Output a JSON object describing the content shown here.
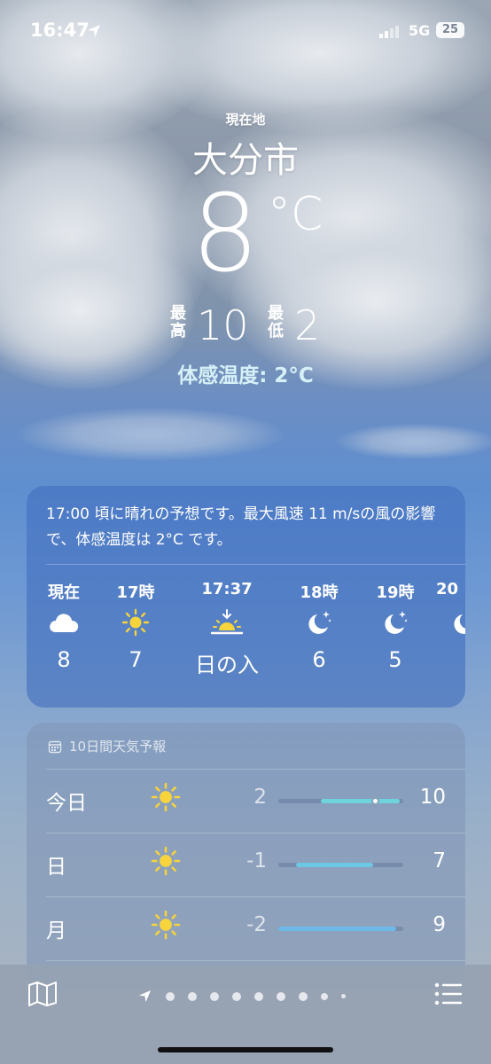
{
  "status": {
    "time": "16:47",
    "network": "5G",
    "battery": "25"
  },
  "hero": {
    "location_label": "現在地",
    "city": "大分市",
    "temp": "8",
    "unit": "°C",
    "high_label": "最高",
    "high": "10",
    "low_label": "最低",
    "low": "2",
    "feels_like": "体感温度: 2°C"
  },
  "hourly": {
    "summary": "17:00 頃に晴れの予想です。最大風速 11 m/sの風の影響で、体感温度は 2°C です。",
    "items": [
      {
        "label": "現在",
        "icon": "cloud-icon",
        "temp": "8"
      },
      {
        "label": "17時",
        "icon": "sun-icon",
        "temp": "7"
      },
      {
        "label": "17:37",
        "icon": "sunset-icon",
        "temp": "日の入"
      },
      {
        "label": "18時",
        "icon": "moon-stars-icon",
        "temp": "6"
      },
      {
        "label": "19時",
        "icon": "moon-stars-icon",
        "temp": "5"
      },
      {
        "label": "20",
        "icon": "moon-stars-icon",
        "temp": ""
      }
    ]
  },
  "daily": {
    "header": "10日間天気予報",
    "rows": [
      {
        "day": "今日",
        "icon": "sun-icon",
        "low": "2",
        "high": "10",
        "range_start": 0.34,
        "range_end": 0.97,
        "current_marker": 0.78
      },
      {
        "day": "日",
        "icon": "sun-icon",
        "low": "-1",
        "high": "7",
        "range_start": 0.14,
        "range_end": 0.76
      },
      {
        "day": "月",
        "icon": "sun-icon",
        "low": "-2",
        "high": "9",
        "range_start": 0.0,
        "range_end": 0.94
      }
    ]
  },
  "colors": {
    "feels_text": "#d6f0f7",
    "sun": "#f7d43b",
    "bar_today": "#6fd3dd",
    "bar_sun": "#6cc7e3",
    "bar_mon": "#6db9e8"
  },
  "bottom": {
    "map_icon": "map-icon",
    "list_icon": "list-icon",
    "page_count": 9
  }
}
